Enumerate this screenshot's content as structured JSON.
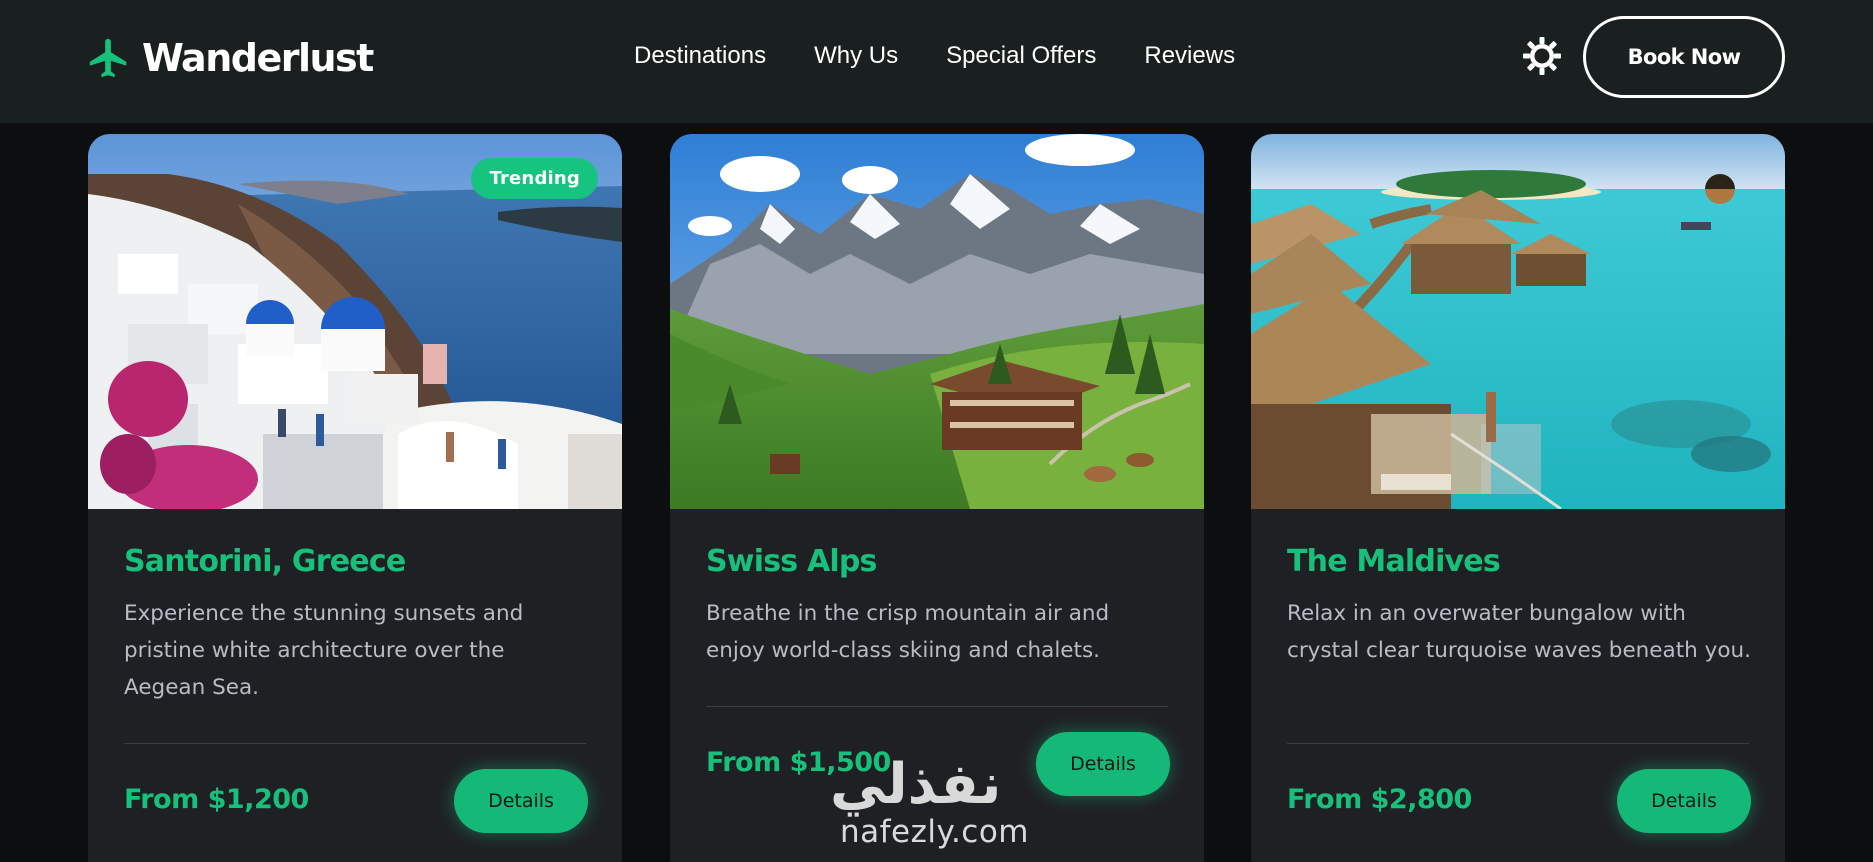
{
  "header": {
    "brand": "Wanderlust",
    "nav": [
      "Destinations",
      "Why Us",
      "Special Offers",
      "Reviews"
    ],
    "theme_icon": "sun-icon",
    "cta_label": "Book Now"
  },
  "colors": {
    "accent": "#17c07b",
    "header_bg": "#1a201f",
    "card_bg": "#1f2024",
    "page_bg": "#0d0e10"
  },
  "cards": [
    {
      "title": "Santorini, Greece",
      "description": "Experience the stunning sunsets and pristine white architecture over the Aegean Sea.",
      "price": "From $1,200",
      "button": "Details",
      "badge": "Trending",
      "image": "santorini-photo"
    },
    {
      "title": "Swiss Alps",
      "description": "Breathe in the crisp mountain air and enjoy world-class skiing and chalets.",
      "price": "From $1,500",
      "button": "Details",
      "image": "swiss-alps-photo"
    },
    {
      "title": "The Maldives",
      "description": "Relax in an overwater bungalow with crystal clear turquoise waves beneath you.",
      "price": "From $2,800",
      "button": "Details",
      "image": "maldives-photo"
    }
  ],
  "watermark": {
    "arabic": "نفذلي",
    "latin": "nafezly.com"
  }
}
